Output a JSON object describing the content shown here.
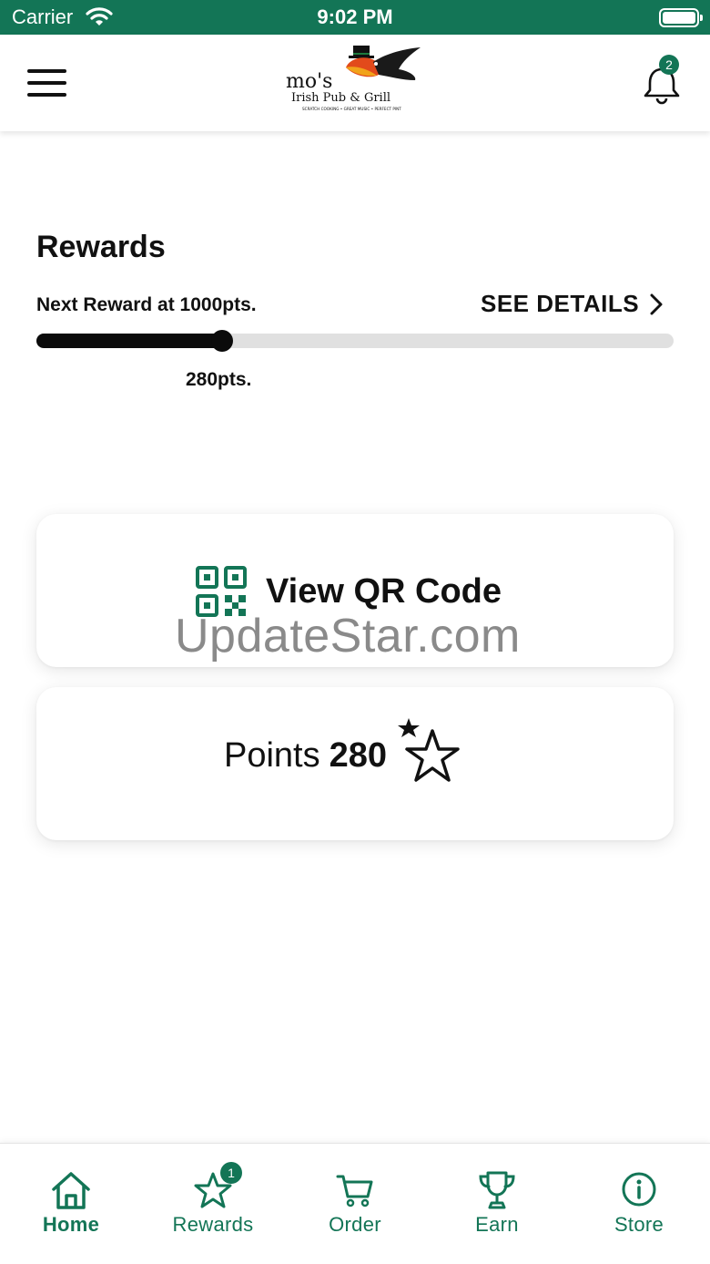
{
  "status_bar": {
    "carrier": "Carrier",
    "time": "9:02 PM"
  },
  "header": {
    "logo": {
      "name": "mo's",
      "line2": "Irish Pub & Grill",
      "tagline": "SCRATCH COOKING • GREAT MUSIC • PERFECT PINT"
    },
    "notification_count": "2"
  },
  "rewards": {
    "title": "Rewards",
    "next_reward": "Next Reward at 1000pts.",
    "see_details": "SEE DETAILS",
    "current_points_label": "280pts.",
    "progress": {
      "current": 280,
      "target": 1000
    }
  },
  "qr_card": {
    "label": "View QR Code"
  },
  "watermark": "UpdateStar.com",
  "points_card": {
    "label": "Points",
    "value": "280"
  },
  "tabs": [
    {
      "label": "Home",
      "icon": "home-icon",
      "active": true
    },
    {
      "label": "Rewards",
      "icon": "star-icon",
      "badge": "1"
    },
    {
      "label": "Order",
      "icon": "cart-icon"
    },
    {
      "label": "Earn",
      "icon": "trophy-icon"
    },
    {
      "label": "Store",
      "icon": "info-icon"
    }
  ],
  "colors": {
    "brand_green": "#137556",
    "progress_fill": "#0b0b0b",
    "progress_track": "#e0e0e0"
  }
}
